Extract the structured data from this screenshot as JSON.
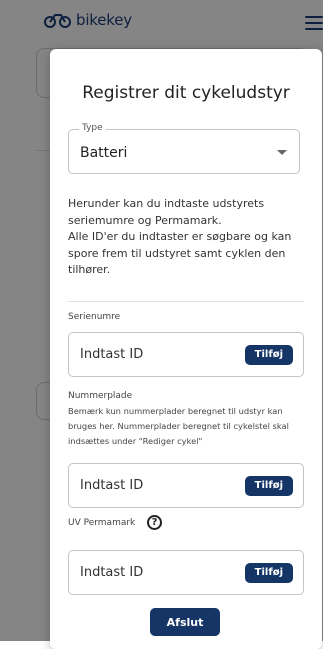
{
  "header": {
    "logo_text": "bikekey"
  },
  "modal": {
    "title": "Registrer dit cykeludstyr",
    "type_select": {
      "label": "Type",
      "value": "Batteri"
    },
    "description": [
      "Herunder kan du indtaste udstyrets seriemumre og Permamark.",
      "Alle ID'er du indtaster er søgbare og kan spore frem til udstyret samt cyklen den tilhører."
    ],
    "serial": {
      "label": "Serienumre",
      "placeholder": "Indtast ID",
      "button": "Tilføj"
    },
    "plate": {
      "label": "Nummerplade",
      "note": "Bemærk kun nummerplader beregnet til udstyr kan bruges her. Nummerplader beregnet til cykelstel skal indsættes under \"Rediger cykel\"",
      "placeholder": "Indtast ID",
      "button": "Tilføj"
    },
    "uv": {
      "label": "UV Permamark",
      "help_icon": "?",
      "placeholder": "Indtast ID",
      "button": "Tilføj"
    },
    "finish_button": "Afslut"
  },
  "colors": {
    "primary": "#143566",
    "overlay": "rgba(0,0,0,0.48)"
  },
  "icons": [
    "bike-logo-icon",
    "hamburger-menu-icon",
    "dropdown-caret-icon",
    "help-circle-icon"
  ]
}
